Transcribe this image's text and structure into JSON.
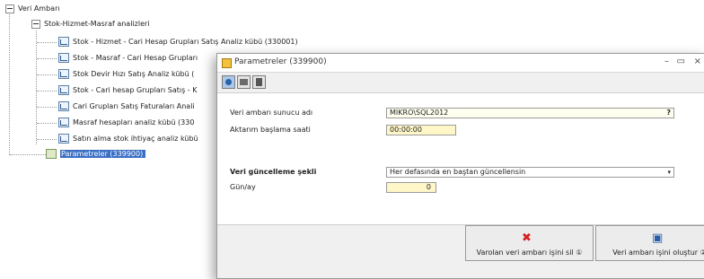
{
  "tree": {
    "root": "Veri Ambarı",
    "group": "Stok-Hizmet-Masraf analizleri",
    "items": [
      "Stok - Hizmet - Cari Hesap Grupları Satış Analiz kübü (330001)",
      "Stok - Masraf - Cari Hesap Grupları",
      "Stok Devir Hızı Satış Analiz kübü (",
      "Stok - Cari hesap Grupları Satış - K",
      "Cari Grupları Satış Faturaları Anali",
      "Masraf hesapları analiz kübü (330",
      "Satın alma stok ihtiyaç analiz kübü"
    ],
    "selected": "Parametreler (339900)"
  },
  "dialog": {
    "title": "Parametreler (339900)",
    "controls": {
      "minimize": "–",
      "maximize": "▭",
      "close": "×"
    },
    "fields": {
      "server_label": "Veri ambarı sunucu adı",
      "server_value": "MIKRO\\SQL2012",
      "server_suffix": "?",
      "start_label": "Aktarım başlama saati",
      "start_value": "00:00:00",
      "update_label": "Veri güncelleme şekli",
      "update_value": "Her defasında en baştan güncellensin",
      "update_caret": "▾",
      "day_label": "Gün/ay",
      "day_value": "0"
    },
    "buttons": {
      "delete_label": "Varolan veri ambarı işini sil ①",
      "delete_icon": "✖",
      "create_label": "Veri ambarı işini oluştur ②",
      "create_icon": "▣"
    }
  }
}
